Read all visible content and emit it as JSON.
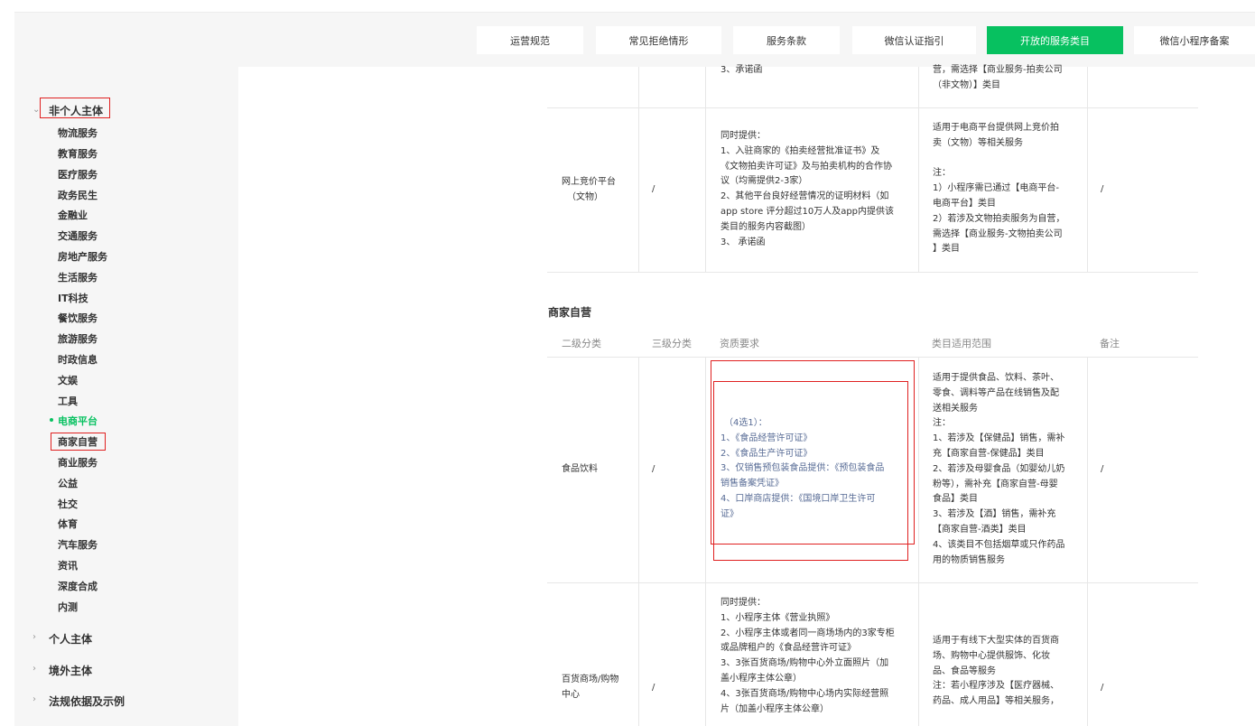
{
  "topnav": {
    "items": [
      "运营规范",
      "常见拒绝情形",
      "服务条款",
      "微信认证指引",
      "开放的服务类目",
      "微信小程序备案"
    ],
    "active_index": 4,
    "accent": "#07c160"
  },
  "sidebar": {
    "group_nonpersonal": "非个人主体",
    "items": [
      "物流服务",
      "教育服务",
      "医疗服务",
      "政务民生",
      "金融业",
      "交通服务",
      "房地产服务",
      "生活服务",
      "IT科技",
      "餐饮服务",
      "旅游服务",
      "时政信息",
      "文娱",
      "工具",
      "电商平台",
      "商家自营",
      "商业服务",
      "公益",
      "社交",
      "体育",
      "汽车服务",
      "资讯",
      "深度合成",
      "内测"
    ],
    "active_item": "电商平台",
    "other_groups": [
      "个人主体",
      "境外主体",
      "法规依据及示例"
    ]
  },
  "table_top": {
    "row_partial": {
      "col3": "3、承诺函",
      "col4": [
        "营，需选择【商业服务-拍卖公司",
        "（非文物）】类目"
      ]
    },
    "row_auction": {
      "col1": [
        "网上竞价平台",
        "（文物）"
      ],
      "col2": "/",
      "col3": [
        "同时提供：",
        "1、入驻商家的《拍卖经营批准证书》及",
        "《文物拍卖许可证》及与拍卖机构的合作协",
        "议（均需提供2-3家）",
        "2、其他平台良好经营情况的证明材料（如",
        "app store 评分超过10万人及app内提供该",
        "类目的服务内容截图）",
        "3、 承诺函"
      ],
      "col4": [
        "适用于电商平台提供网上竞价拍",
        "卖（文物）等相关服务",
        "",
        "注：",
        "1）小程序需已通过【电商平台-",
        "电商平台】类目",
        "2）若涉及文物拍卖服务为自营，",
        "需选择【商业服务-文物拍卖公司",
        "】类目"
      ],
      "col5": "/"
    }
  },
  "section_title": "商家自营",
  "table_headers": [
    "二级分类",
    "三级分类",
    "资质要求",
    "类目适用范围",
    "备注"
  ],
  "rows": [
    {
      "col1": "食品饮料",
      "col2": "/",
      "col3": [
        "（4选1）：",
        "1、《食品经营许可证》",
        "2、《食品生产许可证》",
        "3、仅销售预包装食品提供：《预包装食品",
        "销售备案凭证》",
        "4、口岸商店提供：《国境口岸卫生许可",
        "证》"
      ],
      "col4": [
        "适用于提供食品、饮料、茶叶、",
        "零食、调料等产品在线销售及配",
        "送相关服务",
        "注：",
        "1、若涉及【保健品】销售，需补",
        "充【商家自营-保健品】类目",
        "2、若涉及母婴食品（如婴幼儿奶",
        "粉等），需补充【商家自营-母婴",
        "食品】类目",
        "3、若涉及【酒】销售，需补充",
        "【商家自营-酒类】类目",
        "4、该类目不包括烟草或只作药品",
        "用的物质销售服务"
      ],
      "col5": "/"
    },
    {
      "col1": [
        "百货商场/购物",
        "中心"
      ],
      "col2": "/",
      "col3": [
        "同时提供：",
        "1、小程序主体《营业执照》",
        "2、小程序主体或者同一商场场内的3家专柜",
        "或品牌租户的《食品经营许可证》",
        "3、3张百货商场/购物中心外立面照片（加",
        "盖小程序主体公章）",
        "4、3张百货商场/购物中心场内实际经营照",
        "片（加盖小程序主体公章）"
      ],
      "col4": [
        "适用于有线下大型实体的百货商",
        "场、购物中心提供服饰、化妆",
        "品、食品等服务",
        "注：若小程序涉及【医疗器械、",
        "药品、成人用品】等相关服务，"
      ],
      "col5": "/"
    }
  ]
}
